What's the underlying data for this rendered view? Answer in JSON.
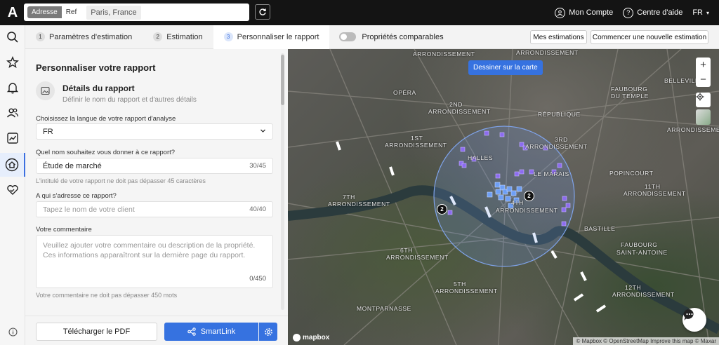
{
  "topbar": {
    "logo": "A",
    "search_modes": [
      "Adresse",
      "Ref"
    ],
    "address_value": "Paris, France",
    "account": "Mon Compte",
    "help": "Centre d'aide",
    "language": "FR"
  },
  "steps": [
    {
      "num": "1",
      "label": "Paramètres d'estimation"
    },
    {
      "num": "2",
      "label": "Estimation"
    },
    {
      "num": "3",
      "label": "Personnaliser le rapport"
    }
  ],
  "toggle_label": "Propriétés comparables",
  "buttons": {
    "my_estimates": "Mes estimations",
    "new_estimate": "Commencer une nouvelle estimation",
    "download_pdf": "Télécharger le PDF",
    "smartlink": "SmartLink",
    "draw_map": "Dessiner sur la carte"
  },
  "form": {
    "title": "Personnaliser votre rapport",
    "section_title": "Détails du rapport",
    "section_sub": "Définir le nom du rapport et d'autres détails",
    "lang_label": "Choisissez la langue de votre rapport d'analyse",
    "lang_value": "FR",
    "name_label": "Quel nom souhaitez vous donner à ce rapport?",
    "name_value": "Étude de marché",
    "name_count": "30/45",
    "name_help": "L'intitulé de votre rapport ne doit pas dépasser 45 caractères",
    "client_label": "A qui s'adresse ce rapport?",
    "client_placeholder": "Tapez le nom de votre client",
    "client_count": "40/40",
    "comment_label": "Votre commentaire",
    "comment_placeholder": "Veuillez ajouter votre commentaire ou description de la propriété. Ces informations apparaîtront sur la dernière page du rapport.",
    "comment_count": "0/450",
    "comment_help": "Votre commentaire ne doit pas dépasser 450 mots"
  },
  "map": {
    "labels": {
      "arr1_top": "ARRONDISSEMENT",
      "arr1_top2": "ARRONDISSEMENT",
      "opera": "OPÉRA",
      "arr2": "2ND",
      "arr2b": "ARRONDISSEMENT",
      "arr3": "3RD",
      "arr3b": "ARRONDISSEMENT",
      "republique": "RÉPUBLIQUE",
      "faubourg": "FAUBOURG",
      "dutemple": "DU TEMPLE",
      "arr1": "1ST",
      "arr1b": "ARRONDISSEMENT",
      "halles": "HALLES",
      "marais": "LE MARAIS",
      "popincourt": "POPINCOURT",
      "arr11": "11TH",
      "arr11b": "ARRONDISSEMENT",
      "arr7": "7TH",
      "arr7b": "ARRONDISSEMENT",
      "arr4": "4TH",
      "arr4b": "ARRONDISSEMENT",
      "bastille": "BASTILLE",
      "fbg_sa": "FAUBOURG",
      "fbg_sa2": "SAINT-ANTOINE",
      "arr6": "6TH",
      "arr6b": "ARRONDISSEMENT",
      "arr5": "5TH",
      "arr5b": "ARRONDISSEMENT",
      "arr12": "12TH",
      "arr12b": "ARRONDISSEMENT",
      "montparnasse": "MONTPARNASSE",
      "belleville": "BELLEVILLE",
      "arr12c": "ARRONDISSEMENT"
    },
    "clusters": [
      "2",
      "2"
    ],
    "mapbox": "mapbox",
    "attribution": "© Mapbox © OpenStreetMap  Improve this map © Maxar"
  }
}
